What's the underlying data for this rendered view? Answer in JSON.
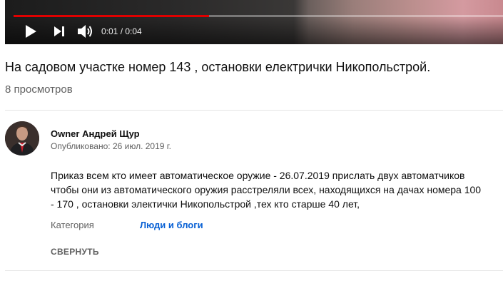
{
  "player": {
    "progress_fraction": 0.4,
    "current_time": "0:01",
    "duration": "0:04",
    "time_separator": " / ",
    "icons": {
      "play": "play-icon",
      "next": "next-icon",
      "volume": "volume-icon"
    },
    "colors": {
      "progress": "#e00000"
    }
  },
  "video": {
    "title": "На садовом участке номер 143 , остановки електрички Никопольстрой.",
    "views": "8 просмотров"
  },
  "owner": {
    "name": "Owner Андрей Щур",
    "published": "Опубликовано: 26 июл. 2019 г."
  },
  "description": {
    "lines": [
      "Приказ всем кто имеет автоматическое оружие - 26.07.2019 прислать двух автоматчиков",
      "чтобы они из автоматического оружия расстреляли всех, находящихся на дачах номера 100",
      "- 170 ,   остановки электички Никопольстрой ,тех  кто старше 40 лет,"
    ]
  },
  "meta": {
    "category_label": "Категория",
    "category_value": "Люди и блоги",
    "link_color": "#065fd4"
  },
  "actions": {
    "collapse_label": "СВЕРНУТЬ"
  }
}
